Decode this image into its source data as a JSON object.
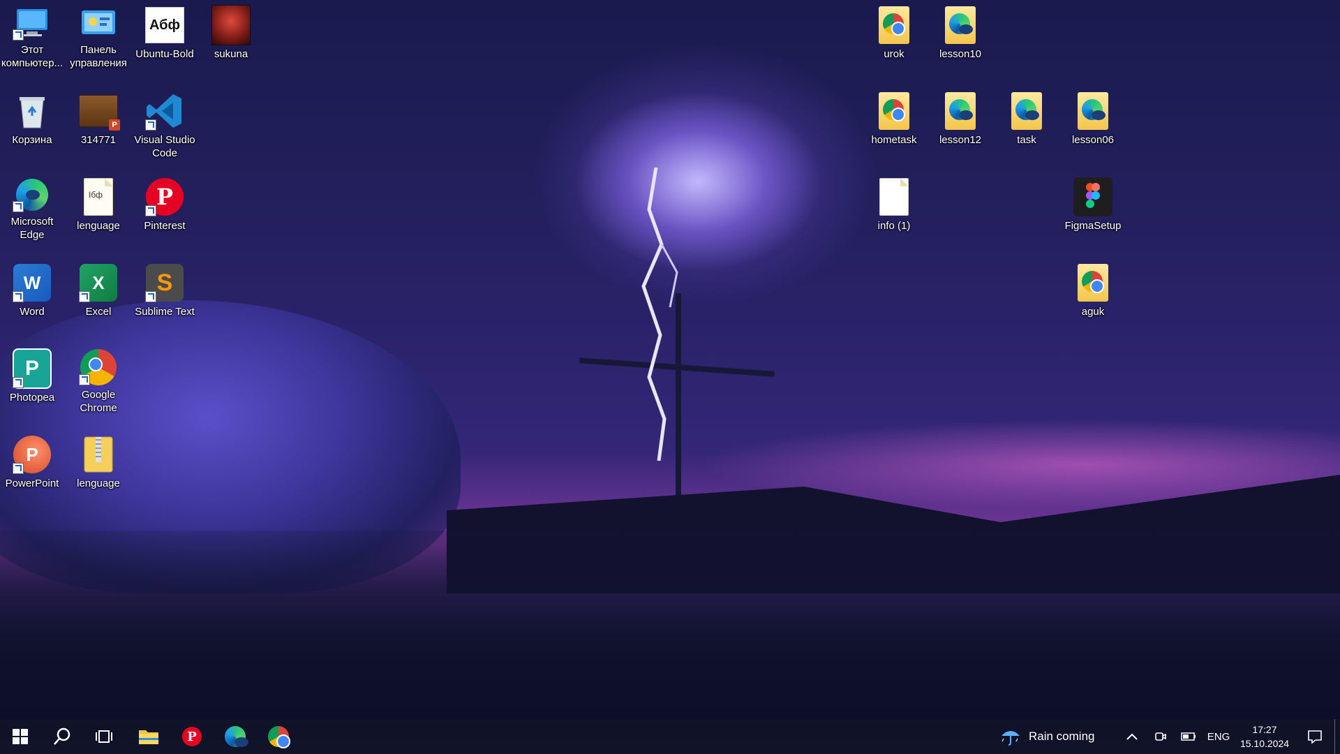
{
  "desktop": {
    "icons": {
      "this_pc": "Этот компьютер...",
      "control_panel": "Панель управления",
      "ubuntu_bold": "Ubuntu-Bold",
      "ubuntu_bold_glyph": "Абф",
      "sukuna": "sukuna",
      "recycle_bin": "Корзина",
      "file_314771": "314771",
      "vscode": "Visual Studio Code",
      "edge": "Microsoft Edge",
      "lenguage_doc": "lenguage",
      "lenguage_doc_glyph": "Iбф",
      "pinterest": "Pinterest",
      "word": "Word",
      "excel": "Excel",
      "sublime": "Sublime Text",
      "photopea": "Photopea",
      "chrome": "Google Chrome",
      "powerpoint": "PowerPoint",
      "lenguage_zip": "lenguage",
      "urok": "urok",
      "lesson10": "lesson10",
      "hometask": "hometask",
      "lesson12": "lesson12",
      "task": "task",
      "lesson06": "lesson06",
      "info1": "info (1)",
      "figmasetup": "FigmaSetup",
      "aguk": "aguk"
    }
  },
  "taskbar": {
    "weather_text": "Rain coming",
    "language": "ENG",
    "time": "17:27",
    "date": "15.10.2024"
  },
  "colors": {
    "taskbar_bg": "#111328",
    "accent_blue": "#0078d4"
  }
}
